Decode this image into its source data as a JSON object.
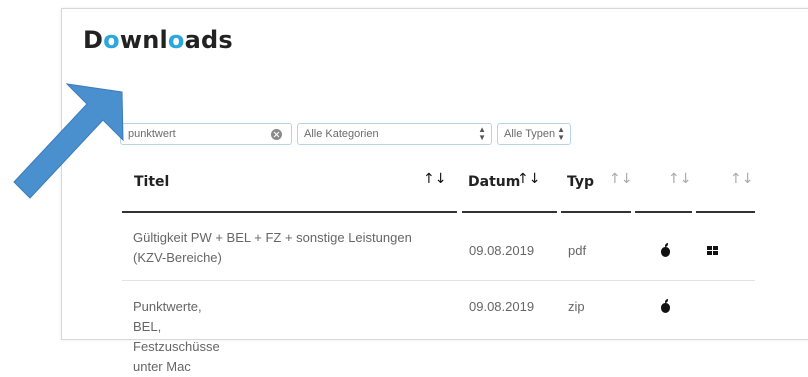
{
  "page": {
    "title_parts": [
      "D",
      "o",
      "wnl",
      "o",
      "ads"
    ]
  },
  "filters": {
    "search_value": "punktwert",
    "category_selected": "Alle Kategorien",
    "type_selected": "Alle Typen"
  },
  "table": {
    "headers": {
      "title": "Titel",
      "date": "Datum",
      "type": "Typ"
    },
    "rows": [
      {
        "title_line1": "Gültigkeit PW + BEL + FZ + sonstige Leistungen",
        "title_line2": "(KZV-Bereiche)",
        "date": "09.08.2019",
        "type": "pdf",
        "icons": [
          "apple-icon",
          "windows-icon"
        ]
      },
      {
        "title_line1": "Punktwerte, BEL, Festzuschüsse unter Mac",
        "date": "09.08.2019",
        "type": "zip",
        "icons": [
          "apple-icon"
        ]
      }
    ]
  },
  "colors": {
    "accent": "#2aa7df",
    "arrow": "#4a8fce",
    "field_border": "#b7d3e6"
  }
}
